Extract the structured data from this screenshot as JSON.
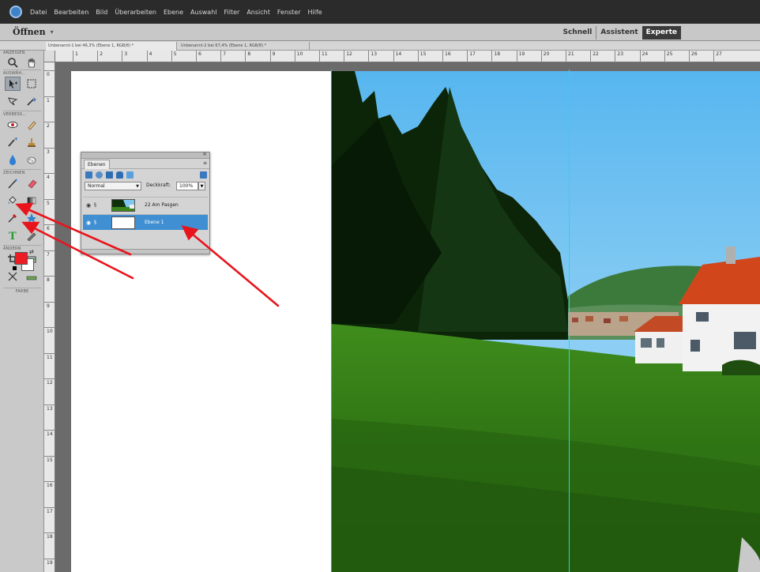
{
  "menubar": {
    "items": [
      "Datei",
      "Bearbeiten",
      "Bild",
      "Überarbeiten",
      "Ebene",
      "Auswahl",
      "Filter",
      "Ansicht",
      "Fenster",
      "Hilfe"
    ]
  },
  "modebar": {
    "open_label": "Öffnen",
    "modes": [
      "Schnell",
      "Assistent",
      "Experte"
    ],
    "active_mode": "Experte"
  },
  "doc_tabs": [
    "Unbenannt-1 bei 46,3% (Ebene 1, RGB/8) *",
    "Unbenannt-2 bei 67,4% (Ebene 1, RGB/8) *"
  ],
  "ruler": {
    "h_labels": [
      "1",
      "2",
      "3",
      "4",
      "5",
      "6",
      "7",
      "8",
      "9",
      "10",
      "11",
      "12",
      "13",
      "14",
      "15",
      "16",
      "17",
      "18",
      "19",
      "20",
      "21",
      "22",
      "23",
      "24",
      "25",
      "26",
      "27"
    ],
    "v_labels": [
      "0",
      "1",
      "2",
      "3",
      "4",
      "5",
      "6",
      "7",
      "8",
      "9",
      "10",
      "11",
      "12",
      "13",
      "14",
      "15",
      "16",
      "17",
      "18",
      "19"
    ]
  },
  "toolbox": {
    "sections": [
      "ANZEIGEN",
      "AUSWÄH...",
      "VERBESS...",
      "ZEICHNEN",
      "ÄNDERN",
      "FARBE"
    ],
    "foreground_color": "#ed1c24",
    "background_color": "#ffffff"
  },
  "layers_panel": {
    "tab_label": "Ebenen",
    "blend_mode": "Normal",
    "opacity_label": "Deckkraft:",
    "opacity_value": "100%",
    "layers": [
      {
        "name": "22 Am Pasgen",
        "selected": false
      },
      {
        "name": "Ebene 1",
        "selected": true
      }
    ]
  },
  "colors": {
    "selection": "#3f8fd2",
    "guide": "#2fd3e0",
    "annotation_arrow": "#e8141c"
  }
}
